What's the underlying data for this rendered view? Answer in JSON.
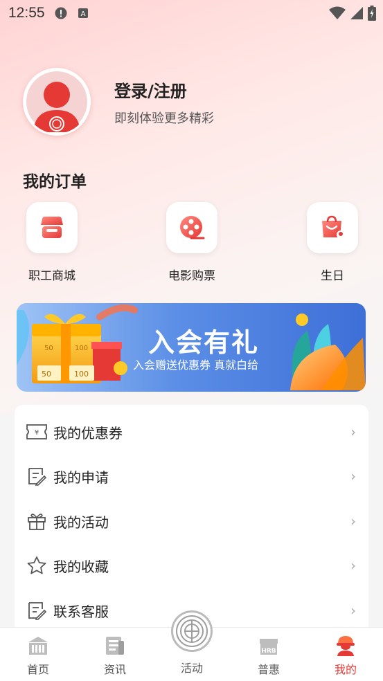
{
  "status_bar": {
    "time": "12:55"
  },
  "profile": {
    "title": "登录/注册",
    "subtitle": "即刻体验更多精彩"
  },
  "orders": {
    "section_title": "我的订单",
    "items": [
      {
        "label": "职工商城",
        "icon": "shop-icon"
      },
      {
        "label": "电影购票",
        "icon": "film-reel-icon"
      },
      {
        "label": "生日",
        "icon": "birthday-bag-icon"
      }
    ]
  },
  "banner": {
    "title": "入会有礼",
    "subtitle": "入会赠送优惠券 真就白给",
    "coupon_values": [
      "50",
      "100",
      "50",
      "100"
    ]
  },
  "menu": {
    "items": [
      {
        "label": "我的优惠券",
        "icon": "coupon-icon"
      },
      {
        "label": "我的申请",
        "icon": "application-icon"
      },
      {
        "label": "我的活动",
        "icon": "gift-icon"
      },
      {
        "label": "我的收藏",
        "icon": "star-icon"
      },
      {
        "label": "联系客服",
        "icon": "customer-service-icon"
      }
    ]
  },
  "tabbar": {
    "items": [
      {
        "label": "首页",
        "icon": "home-icon"
      },
      {
        "label": "资讯",
        "icon": "news-icon"
      },
      {
        "label": "活动",
        "icon": "activity-logo-icon"
      },
      {
        "label": "普惠",
        "icon": "hrb-icon"
      },
      {
        "label": "我的",
        "icon": "worker-helmet-icon"
      }
    ],
    "active_color": "#e53935"
  },
  "colors": {
    "accent": "#e53935",
    "banner_blue": "#3d6fd8"
  }
}
